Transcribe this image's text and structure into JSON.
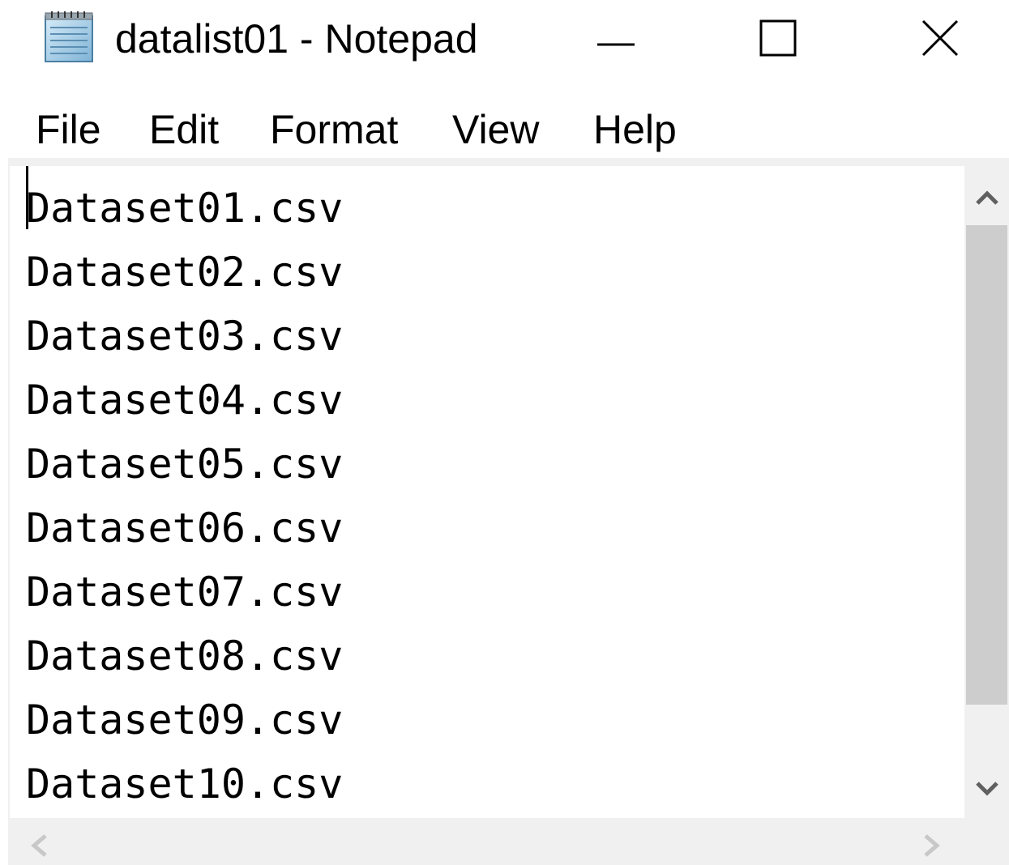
{
  "window": {
    "title": "datalist01 - Notepad"
  },
  "menu": [
    "File",
    "Edit",
    "Format",
    "View",
    "Help"
  ],
  "editor": {
    "lines": [
      "Dataset01.csv",
      "Dataset02.csv",
      "Dataset03.csv",
      "Dataset04.csv",
      "Dataset05.csv",
      "Dataset06.csv",
      "Dataset07.csv",
      "Dataset08.csv",
      "Dataset09.csv",
      "Dataset10.csv"
    ]
  },
  "icons": {
    "app": "notepad-icon",
    "minimize": "minimize-icon",
    "maximize": "maximize-icon",
    "close": "close-icon",
    "scroll_up": "chevron-up-icon",
    "scroll_down": "chevron-down-icon",
    "scroll_left": "chevron-left-icon",
    "scroll_right": "chevron-right-icon"
  },
  "colors": {
    "background": "#ffffff",
    "chrome": "#f0f0f0",
    "scroll_thumb": "#cdcdcd",
    "text": "#000000"
  }
}
